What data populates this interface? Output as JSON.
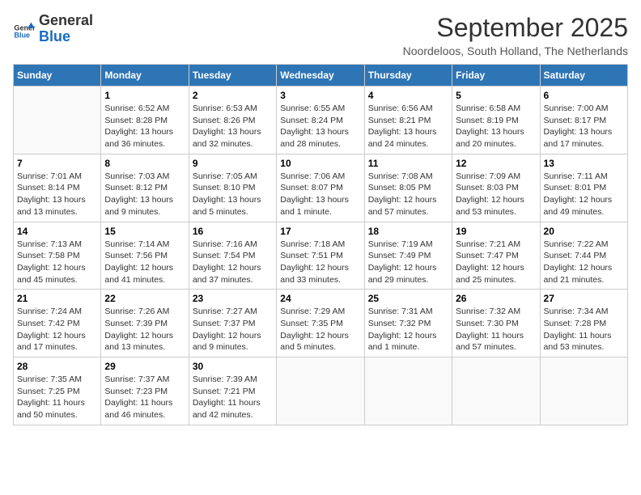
{
  "header": {
    "logo_general": "General",
    "logo_blue": "Blue",
    "month_year": "September 2025",
    "location": "Noordeloos, South Holland, The Netherlands"
  },
  "days_of_week": [
    "Sunday",
    "Monday",
    "Tuesday",
    "Wednesday",
    "Thursday",
    "Friday",
    "Saturday"
  ],
  "weeks": [
    [
      {
        "day": "",
        "info": ""
      },
      {
        "day": "1",
        "info": "Sunrise: 6:52 AM\nSunset: 8:28 PM\nDaylight: 13 hours\nand 36 minutes."
      },
      {
        "day": "2",
        "info": "Sunrise: 6:53 AM\nSunset: 8:26 PM\nDaylight: 13 hours\nand 32 minutes."
      },
      {
        "day": "3",
        "info": "Sunrise: 6:55 AM\nSunset: 8:24 PM\nDaylight: 13 hours\nand 28 minutes."
      },
      {
        "day": "4",
        "info": "Sunrise: 6:56 AM\nSunset: 8:21 PM\nDaylight: 13 hours\nand 24 minutes."
      },
      {
        "day": "5",
        "info": "Sunrise: 6:58 AM\nSunset: 8:19 PM\nDaylight: 13 hours\nand 20 minutes."
      },
      {
        "day": "6",
        "info": "Sunrise: 7:00 AM\nSunset: 8:17 PM\nDaylight: 13 hours\nand 17 minutes."
      }
    ],
    [
      {
        "day": "7",
        "info": "Sunrise: 7:01 AM\nSunset: 8:14 PM\nDaylight: 13 hours\nand 13 minutes."
      },
      {
        "day": "8",
        "info": "Sunrise: 7:03 AM\nSunset: 8:12 PM\nDaylight: 13 hours\nand 9 minutes."
      },
      {
        "day": "9",
        "info": "Sunrise: 7:05 AM\nSunset: 8:10 PM\nDaylight: 13 hours\nand 5 minutes."
      },
      {
        "day": "10",
        "info": "Sunrise: 7:06 AM\nSunset: 8:07 PM\nDaylight: 13 hours\nand 1 minute."
      },
      {
        "day": "11",
        "info": "Sunrise: 7:08 AM\nSunset: 8:05 PM\nDaylight: 12 hours\nand 57 minutes."
      },
      {
        "day": "12",
        "info": "Sunrise: 7:09 AM\nSunset: 8:03 PM\nDaylight: 12 hours\nand 53 minutes."
      },
      {
        "day": "13",
        "info": "Sunrise: 7:11 AM\nSunset: 8:01 PM\nDaylight: 12 hours\nand 49 minutes."
      }
    ],
    [
      {
        "day": "14",
        "info": "Sunrise: 7:13 AM\nSunset: 7:58 PM\nDaylight: 12 hours\nand 45 minutes."
      },
      {
        "day": "15",
        "info": "Sunrise: 7:14 AM\nSunset: 7:56 PM\nDaylight: 12 hours\nand 41 minutes."
      },
      {
        "day": "16",
        "info": "Sunrise: 7:16 AM\nSunset: 7:54 PM\nDaylight: 12 hours\nand 37 minutes."
      },
      {
        "day": "17",
        "info": "Sunrise: 7:18 AM\nSunset: 7:51 PM\nDaylight: 12 hours\nand 33 minutes."
      },
      {
        "day": "18",
        "info": "Sunrise: 7:19 AM\nSunset: 7:49 PM\nDaylight: 12 hours\nand 29 minutes."
      },
      {
        "day": "19",
        "info": "Sunrise: 7:21 AM\nSunset: 7:47 PM\nDaylight: 12 hours\nand 25 minutes."
      },
      {
        "day": "20",
        "info": "Sunrise: 7:22 AM\nSunset: 7:44 PM\nDaylight: 12 hours\nand 21 minutes."
      }
    ],
    [
      {
        "day": "21",
        "info": "Sunrise: 7:24 AM\nSunset: 7:42 PM\nDaylight: 12 hours\nand 17 minutes."
      },
      {
        "day": "22",
        "info": "Sunrise: 7:26 AM\nSunset: 7:39 PM\nDaylight: 12 hours\nand 13 minutes."
      },
      {
        "day": "23",
        "info": "Sunrise: 7:27 AM\nSunset: 7:37 PM\nDaylight: 12 hours\nand 9 minutes."
      },
      {
        "day": "24",
        "info": "Sunrise: 7:29 AM\nSunset: 7:35 PM\nDaylight: 12 hours\nand 5 minutes."
      },
      {
        "day": "25",
        "info": "Sunrise: 7:31 AM\nSunset: 7:32 PM\nDaylight: 12 hours\nand 1 minute."
      },
      {
        "day": "26",
        "info": "Sunrise: 7:32 AM\nSunset: 7:30 PM\nDaylight: 11 hours\nand 57 minutes."
      },
      {
        "day": "27",
        "info": "Sunrise: 7:34 AM\nSunset: 7:28 PM\nDaylight: 11 hours\nand 53 minutes."
      }
    ],
    [
      {
        "day": "28",
        "info": "Sunrise: 7:35 AM\nSunset: 7:25 PM\nDaylight: 11 hours\nand 50 minutes."
      },
      {
        "day": "29",
        "info": "Sunrise: 7:37 AM\nSunset: 7:23 PM\nDaylight: 11 hours\nand 46 minutes."
      },
      {
        "day": "30",
        "info": "Sunrise: 7:39 AM\nSunset: 7:21 PM\nDaylight: 11 hours\nand 42 minutes."
      },
      {
        "day": "",
        "info": ""
      },
      {
        "day": "",
        "info": ""
      },
      {
        "day": "",
        "info": ""
      },
      {
        "day": "",
        "info": ""
      }
    ]
  ]
}
